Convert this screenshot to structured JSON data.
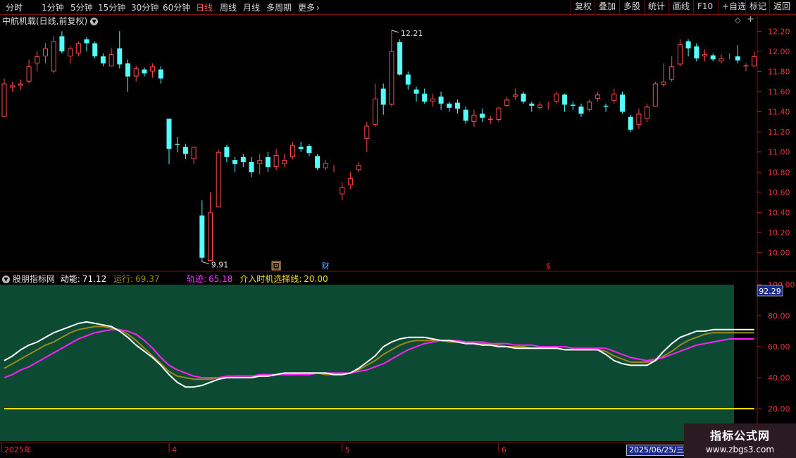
{
  "toolbar": {
    "left_items": [
      {
        "label": "分时",
        "active": false
      },
      {
        "label": "1分钟",
        "active": false
      },
      {
        "label": "5分钟",
        "active": false
      },
      {
        "label": "15分钟",
        "active": false
      },
      {
        "label": "30分钟",
        "active": false
      },
      {
        "label": "60分钟",
        "active": false
      },
      {
        "label": "日线",
        "active": true
      },
      {
        "label": "周线",
        "active": false
      },
      {
        "label": "月线",
        "active": false
      },
      {
        "label": "多周期",
        "active": false
      },
      {
        "label": "更多",
        "active": false
      }
    ],
    "more_arrow": "chevron-right-icon",
    "right_items": [
      "复权",
      "叠加",
      "多股",
      "统计",
      "画线",
      "F10",
      "+自选",
      "标记",
      "返回"
    ]
  },
  "main_chart": {
    "title": "中航机载(日线,前复权)",
    "price_ticks": [
      "12.20",
      "12.00",
      "11.80",
      "11.60",
      "11.40",
      "11.20",
      "11.00",
      "10.80",
      "10.60",
      "10.40",
      "10.20",
      "10.00"
    ],
    "high_label": "12.21",
    "low_label": "9.91",
    "markers": [
      {
        "label": "回",
        "color": "#e0b060"
      },
      {
        "label": "财",
        "color": "#5ab0ff"
      },
      {
        "label": "$",
        "color": "#ff3030"
      }
    ],
    "up_color": "#ff4a4a",
    "down_color": "#54ffff"
  },
  "indicator": {
    "name": "股朋指标网",
    "dongneng_label": "动能:",
    "dongneng_value": "71.12",
    "yunxing_label": "运行:",
    "yunxing_value": "69.37",
    "guiji_label": "轨迹:",
    "guiji_value": "65.18",
    "timing_label": "介入时机选择线:",
    "timing_value": "20.00",
    "current_value_label": "92.29",
    "y_ticks": [
      "100.00",
      "80.00",
      "60.00",
      "40.00",
      "20.00"
    ],
    "panel_bg": "#0c4a34",
    "colors": {
      "dongneng": "#ffffff",
      "yunxing": "#9a8a16",
      "guiji": "#ff22ff",
      "timing": "#f0e000"
    }
  },
  "date_axis": {
    "labels": [
      "2025年",
      "4",
      "5",
      "6"
    ],
    "current_date": "2025/06/25/三"
  },
  "watermark": {
    "line1": "指标公式网",
    "line2": "www.zbgs3.com"
  },
  "chart_data": [
    {
      "type": "candlestick",
      "title": "中航机载(日线,前复权)",
      "ylim": [
        9.85,
        12.3
      ],
      "columns": [
        "open",
        "close",
        "high",
        "low"
      ],
      "candles": [
        [
          11.35,
          11.68,
          11.73,
          11.35
        ],
        [
          11.64,
          11.66,
          11.7,
          11.6
        ],
        [
          11.66,
          11.68,
          11.72,
          11.62
        ],
        [
          11.7,
          11.85,
          11.92,
          11.68
        ],
        [
          11.88,
          11.95,
          12.0,
          11.8
        ],
        [
          11.95,
          12.03,
          12.08,
          11.88
        ],
        [
          11.8,
          12.1,
          12.15,
          11.78
        ],
        [
          12.15,
          12.0,
          12.2,
          11.98
        ],
        [
          11.95,
          12.03,
          12.05,
          11.88
        ],
        [
          11.98,
          12.08,
          12.1,
          11.95
        ],
        [
          12.12,
          12.08,
          12.14,
          12.0
        ],
        [
          12.08,
          11.95,
          12.1,
          11.93
        ],
        [
          11.95,
          11.88,
          11.98,
          11.85
        ],
        [
          11.85,
          11.97,
          12.03,
          11.85
        ],
        [
          12.03,
          11.87,
          12.2,
          11.83
        ],
        [
          11.88,
          11.75,
          11.92,
          11.6
        ],
        [
          11.75,
          11.83,
          11.86,
          11.7
        ],
        [
          11.82,
          11.78,
          11.84,
          11.75
        ],
        [
          11.8,
          11.85,
          11.88,
          11.74
        ],
        [
          11.82,
          11.73,
          11.85,
          11.68
        ],
        [
          11.33,
          11.03,
          11.33,
          10.88
        ],
        [
          11.08,
          11.07,
          11.15,
          11.0
        ],
        [
          11.05,
          10.98,
          11.08,
          10.93
        ],
        [
          10.93,
          11.05,
          11.05,
          10.88
        ],
        [
          10.37,
          9.95,
          10.52,
          9.91
        ],
        [
          9.92,
          10.4,
          10.6,
          9.92
        ],
        [
          10.45,
          11.0,
          11.02,
          10.45
        ],
        [
          11.05,
          10.95,
          11.07,
          10.9
        ],
        [
          10.92,
          10.88,
          10.95,
          10.8
        ],
        [
          10.95,
          10.9,
          10.98,
          10.85
        ],
        [
          10.9,
          10.8,
          10.95,
          10.75
        ],
        [
          10.88,
          10.92,
          10.98,
          10.78
        ],
        [
          10.95,
          10.85,
          11.0,
          10.8
        ],
        [
          10.85,
          10.97,
          11.03,
          10.82
        ],
        [
          10.88,
          10.92,
          10.98,
          10.85
        ],
        [
          10.95,
          11.07,
          11.1,
          10.93
        ],
        [
          11.05,
          11.03,
          11.1,
          11.0
        ],
        [
          11.06,
          10.99,
          11.08,
          10.96
        ],
        [
          10.96,
          10.84,
          10.98,
          10.82
        ],
        [
          10.84,
          10.89,
          10.92,
          10.82
        ],
        [
          10.85,
          10.85,
          10.87,
          10.8
        ],
        [
          10.58,
          10.65,
          10.7,
          10.52
        ],
        [
          10.67,
          10.74,
          10.8,
          10.63
        ],
        [
          10.82,
          10.87,
          10.9,
          10.8
        ],
        [
          11.13,
          11.26,
          11.3,
          11.0
        ],
        [
          11.27,
          11.53,
          11.68,
          11.25
        ],
        [
          11.63,
          11.47,
          11.68,
          11.37
        ],
        [
          11.47,
          12.0,
          12.21,
          11.45
        ],
        [
          12.09,
          11.77,
          12.12,
          11.76
        ],
        [
          11.77,
          11.67,
          11.8,
          11.62
        ],
        [
          11.62,
          11.58,
          11.65,
          11.5
        ],
        [
          11.58,
          11.5,
          11.63,
          11.48
        ],
        [
          11.5,
          11.53,
          11.58,
          11.45
        ],
        [
          11.55,
          11.48,
          11.6,
          11.42
        ],
        [
          11.48,
          11.44,
          11.5,
          11.4
        ],
        [
          11.49,
          11.43,
          11.52,
          11.38
        ],
        [
          11.42,
          11.31,
          11.45,
          11.28
        ],
        [
          11.3,
          11.37,
          11.42,
          11.25
        ],
        [
          11.38,
          11.34,
          11.43,
          11.3
        ],
        [
          11.32,
          11.33,
          11.36,
          11.28
        ],
        [
          11.32,
          11.44,
          11.45,
          11.3
        ],
        [
          11.46,
          11.52,
          11.55,
          11.45
        ],
        [
          11.55,
          11.57,
          11.63,
          11.52
        ],
        [
          11.58,
          11.5,
          11.6,
          11.48
        ],
        [
          11.48,
          11.46,
          11.5,
          11.4
        ],
        [
          11.44,
          11.47,
          11.5,
          11.42
        ],
        [
          11.47,
          11.47,
          11.5,
          11.42
        ],
        [
          11.5,
          11.58,
          11.6,
          11.48
        ],
        [
          11.57,
          11.47,
          11.58,
          11.4
        ],
        [
          11.47,
          11.46,
          11.5,
          11.42
        ],
        [
          11.45,
          11.38,
          11.48,
          11.35
        ],
        [
          11.42,
          11.5,
          11.52,
          11.4
        ],
        [
          11.53,
          11.57,
          11.6,
          11.5
        ],
        [
          11.46,
          11.45,
          11.48,
          11.4
        ],
        [
          11.51,
          11.58,
          11.63,
          11.48
        ],
        [
          11.57,
          11.4,
          11.6,
          11.38
        ],
        [
          11.35,
          11.22,
          11.37,
          11.2
        ],
        [
          11.27,
          11.38,
          11.43,
          11.23
        ],
        [
          11.33,
          11.45,
          11.48,
          11.3
        ],
        [
          11.45,
          11.68,
          11.7,
          11.45
        ],
        [
          11.67,
          11.7,
          11.88,
          11.65
        ],
        [
          11.72,
          11.85,
          11.95,
          11.7
        ],
        [
          11.87,
          12.07,
          12.12,
          11.85
        ],
        [
          12.1,
          12.03,
          12.12,
          11.95
        ],
        [
          12.05,
          11.93,
          12.08,
          11.9
        ],
        [
          11.95,
          11.97,
          12.02,
          11.9
        ],
        [
          11.96,
          11.92,
          11.98,
          11.9
        ],
        [
          11.9,
          11.93,
          11.97,
          11.88
        ],
        [
          11.94,
          11.94,
          11.98,
          11.92
        ],
        [
          11.95,
          11.91,
          12.06,
          11.88
        ],
        [
          11.85,
          11.86,
          11.88,
          11.8
        ],
        [
          11.85,
          11.95,
          12.0,
          11.85
        ]
      ],
      "price_labels": {
        "high": "12.21",
        "low": "9.91"
      }
    },
    {
      "type": "line",
      "title": "股朋指标网",
      "ylim": [
        0,
        100
      ],
      "series": [
        {
          "name": "动能",
          "values": [
            51,
            54,
            58,
            61,
            63,
            66,
            69,
            71,
            73,
            75,
            76,
            75,
            74,
            73,
            70,
            66,
            61,
            57,
            53,
            48,
            42,
            37,
            34,
            34,
            35,
            37,
            39,
            40,
            40,
            40,
            40,
            41,
            41,
            42,
            43,
            43,
            43,
            43,
            43,
            43,
            42,
            42,
            43,
            46,
            50,
            54,
            60,
            63,
            65,
            66,
            66,
            66,
            65,
            64,
            64,
            63,
            62,
            62,
            61,
            61,
            60,
            60,
            59,
            59,
            59,
            59,
            59,
            59,
            58,
            58,
            58,
            58,
            58,
            55,
            51,
            49,
            48,
            48,
            48,
            51,
            57,
            62,
            66,
            68,
            70,
            70,
            71,
            71,
            71,
            71,
            71,
            71
          ]
        },
        {
          "name": "运行",
          "values": [
            46,
            49,
            52,
            55,
            58,
            61,
            63,
            66,
            69,
            71,
            72,
            73,
            73,
            72,
            71,
            68,
            64,
            59,
            54,
            49,
            44,
            41,
            40,
            39,
            39,
            39,
            40,
            40,
            41,
            41,
            41,
            41,
            41,
            42,
            42,
            42,
            43,
            43,
            43,
            42,
            42,
            42,
            43,
            45,
            48,
            51,
            55,
            58,
            61,
            63,
            64,
            64,
            64,
            64,
            63,
            63,
            62,
            62,
            62,
            61,
            61,
            60,
            60,
            60,
            59,
            59,
            59,
            59,
            58,
            58,
            58,
            58,
            58,
            57,
            54,
            52,
            50,
            50,
            50,
            51,
            54,
            57,
            61,
            64,
            66,
            68,
            69,
            69,
            69,
            69,
            69,
            69
          ]
        },
        {
          "name": "轨迹",
          "values": [
            40,
            42,
            45,
            47,
            50,
            53,
            56,
            59,
            62,
            65,
            67,
            69,
            70,
            71,
            71,
            70,
            68,
            64,
            59,
            53,
            48,
            45,
            43,
            41,
            40,
            40,
            40,
            41,
            41,
            41,
            41,
            42,
            42,
            42,
            42,
            42,
            42,
            42,
            43,
            43,
            43,
            43,
            43,
            44,
            45,
            47,
            49,
            52,
            55,
            58,
            60,
            62,
            63,
            64,
            64,
            64,
            63,
            63,
            63,
            62,
            62,
            62,
            61,
            61,
            61,
            60,
            60,
            60,
            60,
            59,
            59,
            59,
            59,
            59,
            57,
            55,
            53,
            52,
            51,
            52,
            53,
            55,
            57,
            59,
            61,
            62,
            63,
            64,
            65,
            65,
            65,
            65
          ]
        },
        {
          "name": "介入时机选择线",
          "values": [
            20,
            20,
            20,
            20,
            20,
            20,
            20,
            20,
            20,
            20,
            20,
            20,
            20,
            20,
            20,
            20,
            20,
            20,
            20,
            20,
            20,
            20,
            20,
            20,
            20,
            20,
            20,
            20,
            20,
            20,
            20,
            20,
            20,
            20,
            20,
            20,
            20,
            20,
            20,
            20,
            20,
            20,
            20,
            20,
            20,
            20,
            20,
            20,
            20,
            20,
            20,
            20,
            20,
            20,
            20,
            20,
            20,
            20,
            20,
            20,
            20,
            20,
            20,
            20,
            20,
            20,
            20,
            20,
            20,
            20,
            20,
            20,
            20,
            20,
            20,
            20,
            20,
            20,
            20,
            20,
            20,
            20,
            20,
            20,
            20,
            20,
            20,
            20,
            20,
            20,
            20,
            20
          ]
        }
      ]
    }
  ]
}
